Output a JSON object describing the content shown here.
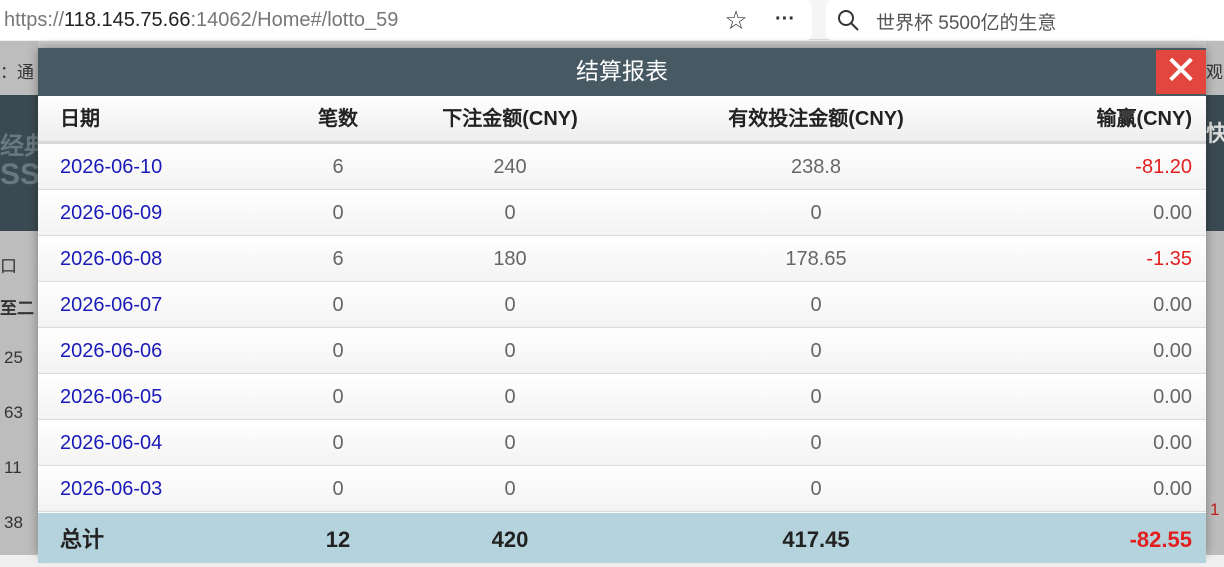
{
  "browser": {
    "url_prefix": "https://",
    "url_host": "118.145.75.66",
    "url_rest": ":14062/Home#/lotto_59",
    "search_text": "世界杯 5500亿的生意"
  },
  "background": {
    "left_labels": [
      "：通",
      "口",
      "至二",
      "25",
      "63",
      "11",
      "38"
    ],
    "right_labels": [
      "观",
      "快",
      "1"
    ],
    "ghost_left": "经典",
    "ghost_left2": "SS"
  },
  "modal": {
    "title": "结算报表",
    "close": "✕",
    "columns": {
      "date": "日期",
      "count": "笔数",
      "bet": "下注金额(CNY)",
      "valid": "有效投注金额(CNY)",
      "win": "输赢(CNY)"
    },
    "rows": [
      {
        "date": "2026-06-10",
        "count": "6",
        "bet": "240",
        "valid": "238.8",
        "win": "-81.20"
      },
      {
        "date": "2026-06-09",
        "count": "0",
        "bet": "0",
        "valid": "0",
        "win": "0.00"
      },
      {
        "date": "2026-06-08",
        "count": "6",
        "bet": "180",
        "valid": "178.65",
        "win": "-1.35"
      },
      {
        "date": "2026-06-07",
        "count": "0",
        "bet": "0",
        "valid": "0",
        "win": "0.00"
      },
      {
        "date": "2026-06-06",
        "count": "0",
        "bet": "0",
        "valid": "0",
        "win": "0.00"
      },
      {
        "date": "2026-06-05",
        "count": "0",
        "bet": "0",
        "valid": "0",
        "win": "0.00"
      },
      {
        "date": "2026-06-04",
        "count": "0",
        "bet": "0",
        "valid": "0",
        "win": "0.00"
      },
      {
        "date": "2026-06-03",
        "count": "0",
        "bet": "0",
        "valid": "0",
        "win": "0.00"
      }
    ],
    "total": {
      "label": "总计",
      "count": "12",
      "bet": "420",
      "valid": "417.45",
      "win": "-82.55"
    }
  },
  "colors": {
    "header_bg": "#475963",
    "close_bg": "#e2463e",
    "date_link": "#1a1ab8",
    "negative": "#e31e1e",
    "total_bg": "#b5d3dc"
  }
}
